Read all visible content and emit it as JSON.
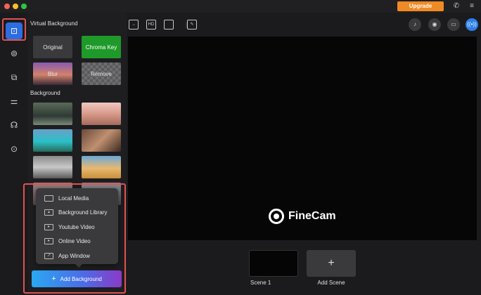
{
  "titlebar": {
    "upgrade_label": "Upgrade"
  },
  "panel": {
    "virtual_bg_title": "Virtual Background",
    "modes": [
      {
        "label": "Original"
      },
      {
        "label": "Chroma Key"
      },
      {
        "label": "Blur"
      },
      {
        "label": "Remove"
      }
    ],
    "background_title": "Background"
  },
  "menu": {
    "items": [
      {
        "label": "Local Media",
        "icon": "folder-icon"
      },
      {
        "label": "Background Library",
        "icon": "image-icon"
      },
      {
        "label": "Youtube Video",
        "icon": "youtube-icon"
      },
      {
        "label": "Online Video",
        "icon": "online-video-icon"
      },
      {
        "label": "App Window",
        "icon": "app-window-icon"
      }
    ]
  },
  "add_background_label": "Add Background",
  "preview": {
    "logo_text": "FineCam"
  },
  "scenes": [
    {
      "label": "Scene 1"
    },
    {
      "label": "Add Scene"
    }
  ],
  "colors": {
    "accent": "#2d6de0",
    "upgrade": "#f08a24",
    "chroma": "#1f9a2a",
    "highlight": "#e05252"
  }
}
